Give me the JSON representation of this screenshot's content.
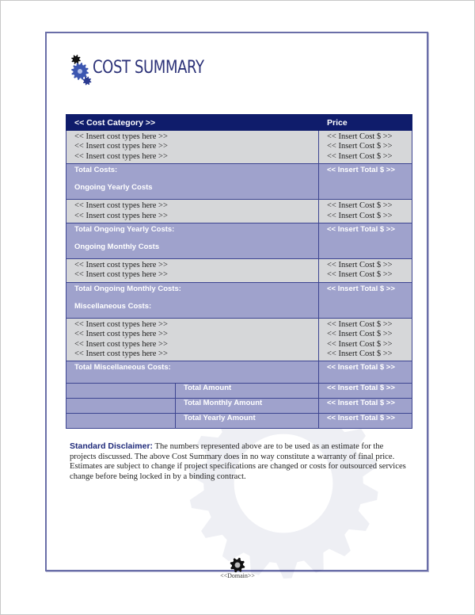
{
  "document": {
    "title": "COST SUMMARY",
    "footer_text": "<<Domain>>"
  },
  "table": {
    "header": {
      "category": "<< Cost Category >>",
      "price": "Price"
    },
    "sections": [
      {
        "items": [
          {
            "type": "<< Insert cost types here >>",
            "cost": "<< Insert Cost $ >>"
          },
          {
            "type": "<< Insert cost types here >>",
            "cost": "<< Insert Cost $ >>"
          },
          {
            "type": "<< Insert cost types here >>",
            "cost": "<< Insert Cost $ >>"
          }
        ],
        "total_label": "Total Costs:",
        "total_value": "<< Insert Total $ >>",
        "next_heading": "Ongoing Yearly Costs"
      },
      {
        "items": [
          {
            "type": "<< Insert cost types here >>",
            "cost": "<< Insert Cost $ >>"
          },
          {
            "type": "<< Insert cost types here >>",
            "cost": "<< Insert Cost $ >>"
          }
        ],
        "total_label": "Total Ongoing Yearly Costs:",
        "total_value": "<< Insert Total $ >>",
        "next_heading": "Ongoing Monthly Costs"
      },
      {
        "items": [
          {
            "type": "<< Insert cost types here >>",
            "cost": "<< Insert Cost $ >>"
          },
          {
            "type": "<< Insert cost types here >>",
            "cost": "<< Insert Cost $ >>"
          }
        ],
        "total_label": "Total Ongoing Monthly Costs:",
        "total_value": "<< Insert Total $ >>",
        "next_heading": "Miscellaneous Costs:"
      },
      {
        "items": [
          {
            "type": "<< Insert cost types here >>",
            "cost": "<< Insert Cost $ >>"
          },
          {
            "type": "<< Insert cost types here >>",
            "cost": "<< Insert Cost $ >>"
          },
          {
            "type": "<< Insert cost types here >>",
            "cost": "<< Insert Cost $ >>"
          },
          {
            "type": "<< Insert cost types here >>",
            "cost": "<< Insert Cost $ >>"
          }
        ],
        "total_label": "Total Miscellaneous Costs:",
        "total_value": "<< Insert Total $ >>",
        "next_heading": ""
      }
    ],
    "summary": [
      {
        "label": "Total Amount",
        "value": "<< Insert Total $ >>"
      },
      {
        "label": "Total Monthly Amount",
        "value": "<< Insert Total $ >>"
      },
      {
        "label": "Total Yearly Amount",
        "value": "<< Insert Total $ >>"
      }
    ]
  },
  "disclaimer": {
    "lead": "Standard Disclaimer:",
    "body": " The numbers represented above are to be used as an estimate for the projects discussed. The above Cost Summary does in no way constitute a warranty of final price. Estimates are subject to change if project specifications are changed or costs for outsourced services change before being locked in by a binding contract."
  },
  "colors": {
    "header_bg": "#0f1c6b",
    "item_bg": "#d6d7d9",
    "total_bg": "#9fa2cc",
    "title_color": "#2c3278",
    "border": "#6a6ea8"
  }
}
